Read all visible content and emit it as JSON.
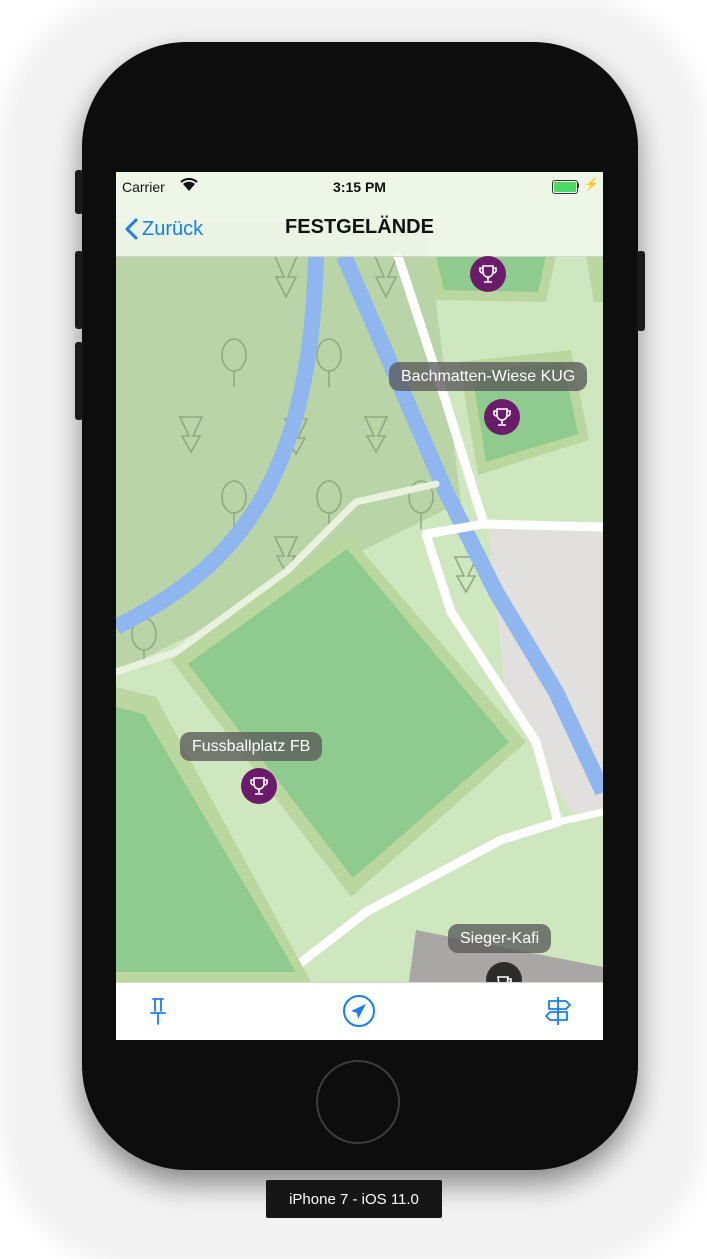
{
  "status_bar": {
    "carrier": "Carrier",
    "time": "3:15 PM"
  },
  "nav": {
    "back_label": "Zurück",
    "title": "FESTGELÄNDE"
  },
  "map": {
    "labels": {
      "bachmatten": "Bachmatten-Wiese KUG",
      "fussballplatz": "Fussballplatz FB",
      "sieger": "Sieger-Kafi"
    },
    "pin_color": "#6a1b6a",
    "water_color": "#8fb6ef",
    "field_color": "#8fcb8e"
  },
  "toolbar": {
    "left_icon": "pushpin-icon",
    "center_icon": "location-arrow-icon",
    "right_icon": "signpost-icon",
    "accent": "#147efb"
  },
  "device": {
    "label": "iPhone 7 - iOS 11.0"
  }
}
